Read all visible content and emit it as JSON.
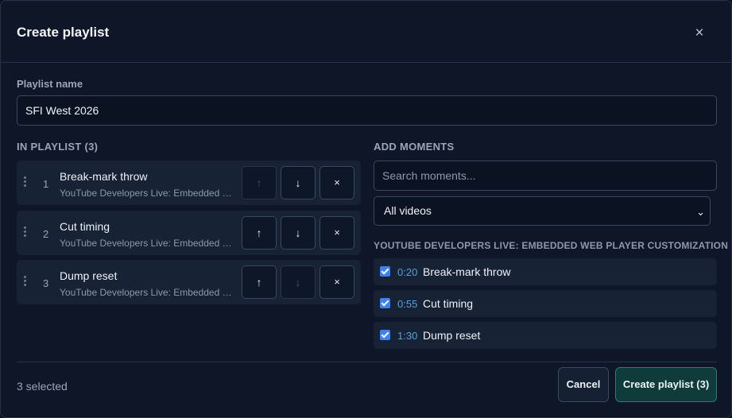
{
  "dialog": {
    "title": "Create playlist",
    "close_glyph": "×"
  },
  "name_field": {
    "label": "Playlist name",
    "value": "SFI West 2026"
  },
  "playlist": {
    "heading": "IN PLAYLIST (3)",
    "items": [
      {
        "index": "1",
        "title": "Break-mark throw",
        "source": "YouTube Developers Live: Embedded W...",
        "up_disabled": true,
        "down_disabled": false
      },
      {
        "index": "2",
        "title": "Cut timing",
        "source": "YouTube Developers Live: Embedded W...",
        "up_disabled": false,
        "down_disabled": false
      },
      {
        "index": "3",
        "title": "Dump reset",
        "source": "YouTube Developers Live: Embedded W...",
        "up_disabled": false,
        "down_disabled": true
      }
    ],
    "up_glyph": "↑",
    "down_glyph": "↓",
    "remove_glyph": "×"
  },
  "add": {
    "heading": "ADD MOMENTS",
    "search_placeholder": "Search moments...",
    "video_filter": "All videos",
    "group_title": "YOUTUBE DEVELOPERS LIVE: EMBEDDED WEB PLAYER CUSTOMIZATION",
    "moments": [
      {
        "time": "0:20",
        "title": "Break-mark throw",
        "checked": true
      },
      {
        "time": "0:55",
        "title": "Cut timing",
        "checked": true
      },
      {
        "time": "1:30",
        "title": "Dump reset",
        "checked": true
      }
    ]
  },
  "footer": {
    "selected": "3 selected",
    "cancel": "Cancel",
    "create": "Create playlist (3)"
  },
  "colors": {
    "accent_time": "#4fa3e0",
    "checkbox": "#3b82f6",
    "primary_button": "#0f3b3a"
  }
}
